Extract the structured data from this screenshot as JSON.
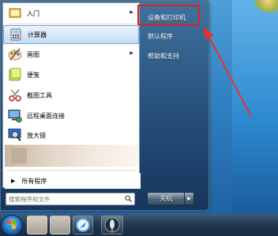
{
  "left_items": [
    {
      "label": "入门",
      "has_submenu": true,
      "icon": "getting-started-icon"
    },
    {
      "label": "计算器",
      "has_submenu": false,
      "icon": "calculator-icon",
      "selected": true
    },
    {
      "label": "画图",
      "has_submenu": true,
      "icon": "paint-icon"
    },
    {
      "label": "便笺",
      "has_submenu": false,
      "icon": "sticky-notes-icon"
    },
    {
      "label": "截图工具",
      "has_submenu": false,
      "icon": "snipping-tool-icon"
    },
    {
      "label": "远程桌面连接",
      "has_submenu": false,
      "icon": "remote-desktop-icon"
    },
    {
      "label": "放大镜",
      "has_submenu": false,
      "icon": "magnifier-icon"
    }
  ],
  "all_programs": "所有程序",
  "search": {
    "placeholder": "搜索程序和文件"
  },
  "right_items": [
    {
      "label": "设备和打印机"
    },
    {
      "label": "默认程序"
    },
    {
      "label": "帮助和支持"
    }
  ],
  "shutdown": {
    "label": "关机"
  },
  "colors": {
    "highlight_box": "#e02020",
    "arrow": "#e83030"
  }
}
